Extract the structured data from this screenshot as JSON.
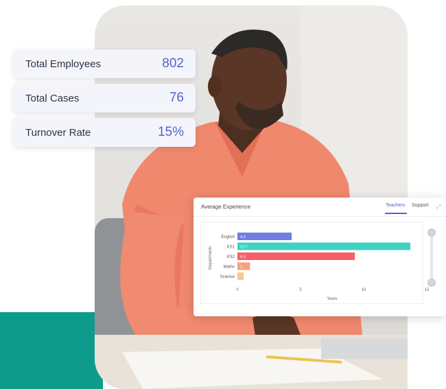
{
  "stats": [
    {
      "label": "Total Employees",
      "value": "802"
    },
    {
      "label": "Total Cases",
      "value": "76"
    },
    {
      "label": "Turnover Rate",
      "value": "15%"
    }
  ],
  "chart": {
    "title": "Average Experience",
    "tabs": [
      "Teachers",
      "Support"
    ],
    "active_tab": "Teachers"
  },
  "colors": {
    "teal": "#0e9b8c",
    "accent": "#5562c9"
  },
  "chart_data": {
    "type": "bar",
    "orientation": "horizontal",
    "title": "Average Experience",
    "xlabel": "Years",
    "ylabel": "Departments",
    "categories": [
      "English",
      "KS1",
      "KS2",
      "Maths",
      "Science"
    ],
    "values": [
      4.3,
      13.7,
      9.3,
      1,
      0.5
    ],
    "value_labels": [
      "4.3",
      "13.7",
      "9.3",
      "1",
      ""
    ],
    "bar_colors": [
      "#6f7ee0",
      "#3fd2c2",
      "#f5606a",
      "#f7a17c",
      "#f9c98e"
    ],
    "xlim": [
      0,
      15
    ],
    "xticks": [
      0,
      5,
      10,
      15
    ],
    "grid": false,
    "legend": "none"
  }
}
